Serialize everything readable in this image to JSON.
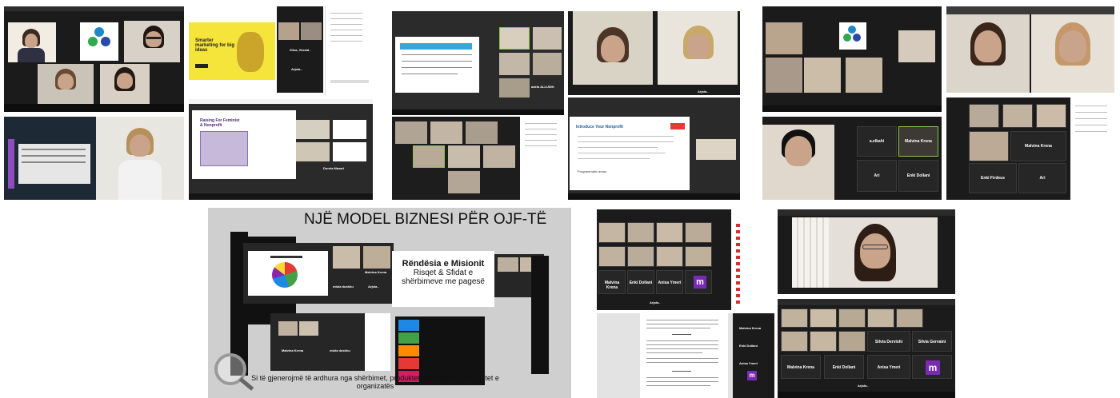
{
  "collage_title": "NJË MODEL BIZNESI PËR OJF-TË",
  "collage_caption": "Si të gjenerojmë të ardhura nga shërbimet, produktet me pagesë  dhe asetet e organizatës",
  "mission_slide": {
    "heading": "Rëndësia e Misionit",
    "line1": "Risqet & Sfidat e",
    "line2": "shërbimeve me pagesë"
  },
  "grant_slide": {
    "title": "Smarter marketing for big ideas"
  },
  "fundraising_slide": {
    "title": "Raising For Feminist & Nonprofit"
  },
  "nonprofit_slide": {
    "title": "Introduce Your Nonprofit",
    "footer_item": "Programmatic areas"
  },
  "names": {
    "adela_guller": "adela ALLUSHI",
    "silva": "Silva, Gerald..",
    "arjola": "Arjola..",
    "malvina": "Malvina Krena",
    "enki": "Enki Dollani",
    "anisa": "Anisa Ymeri",
    "enki_fin": "Enki Firdeus",
    "a_elkahi": "a.elkahi",
    "ari": "Ari",
    "silvia_dervishi": "Silvia Dervishi",
    "silvia_gervaini": "Silvia Gervaini",
    "edola": "edola dushku",
    "dorela": "Dorela Mazari",
    "m_letter": "m"
  },
  "colors": {
    "accent_yellow": "#f5e43a",
    "zoom_dark": "#1b1b1b",
    "mask_purple": "#7a2bb3",
    "gray_bg": "#cfcfcf"
  }
}
